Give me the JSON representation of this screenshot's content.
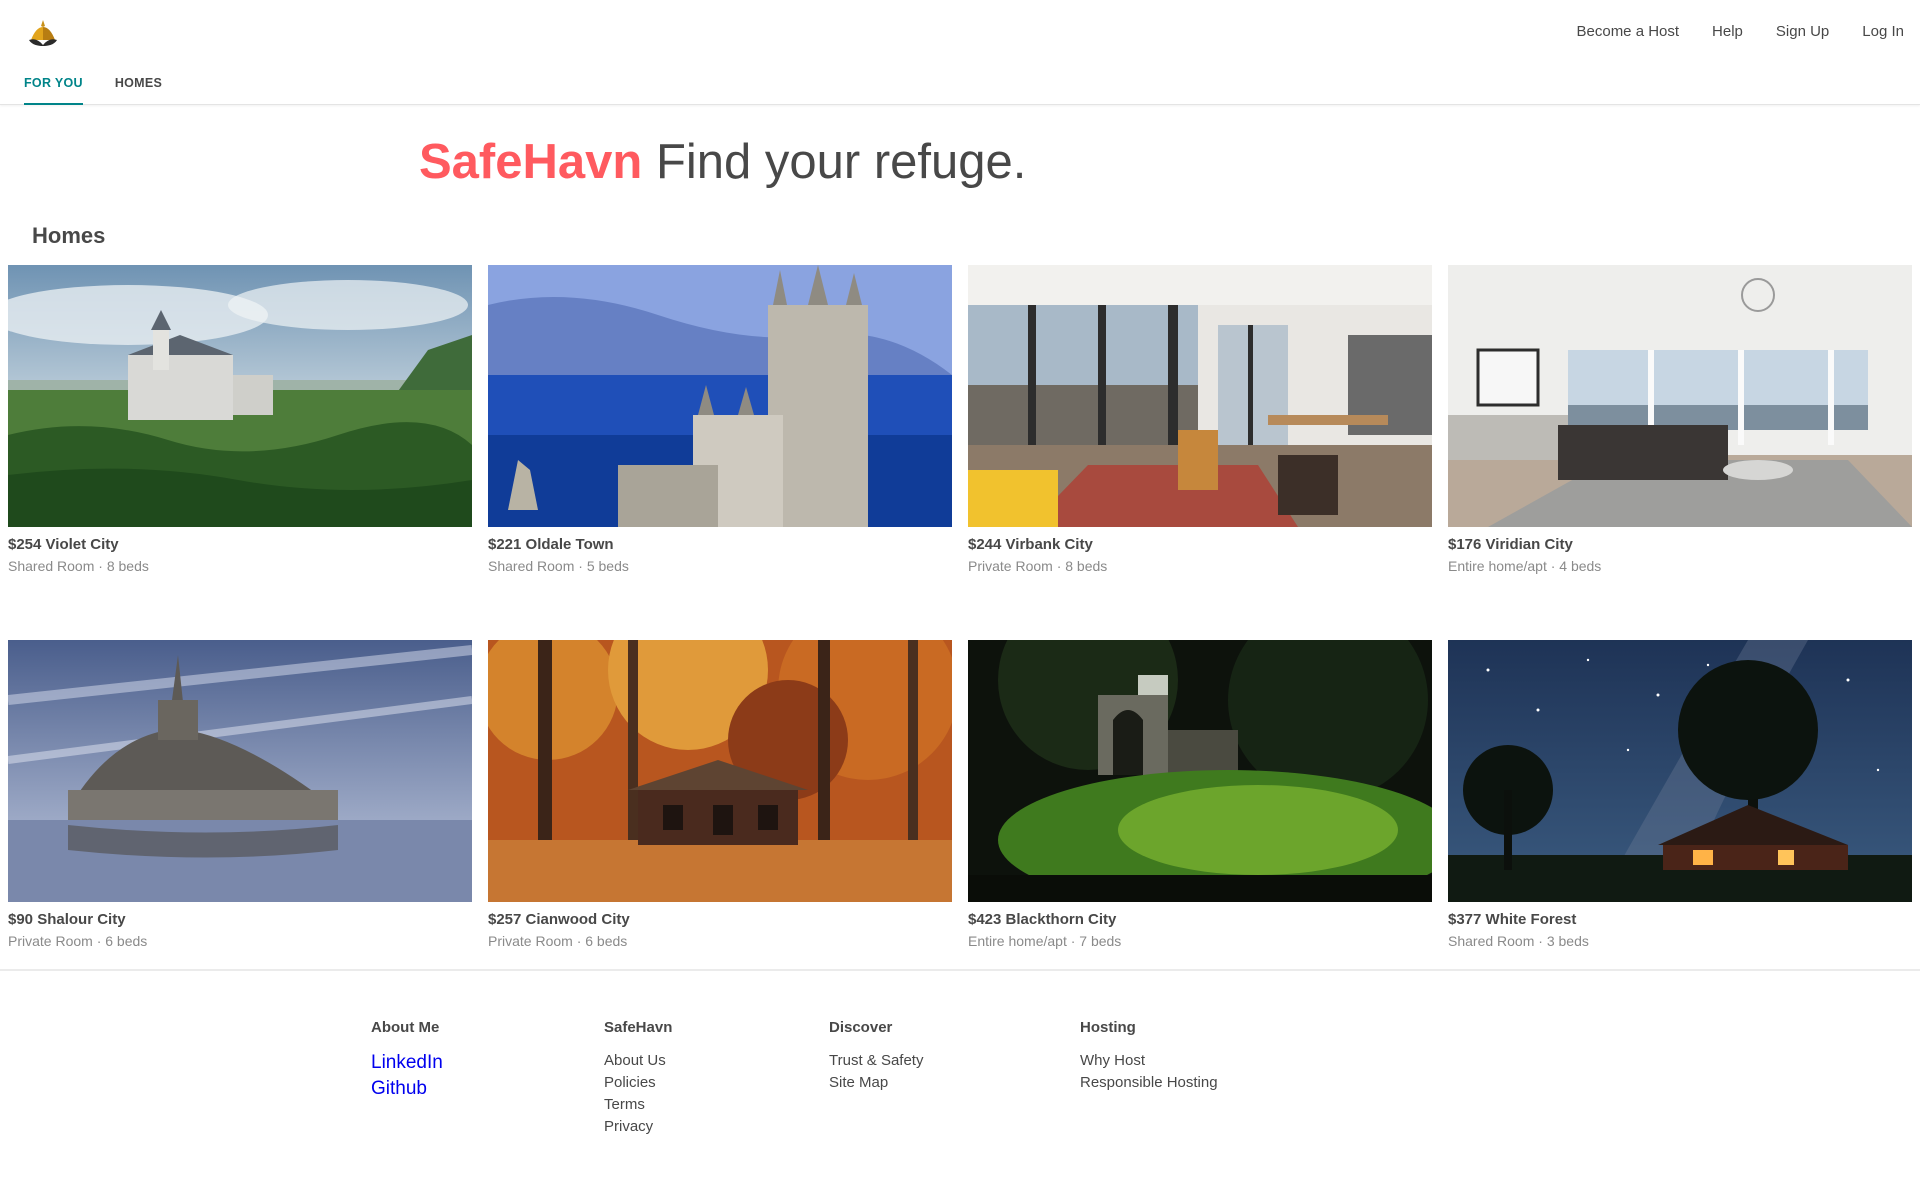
{
  "header": {
    "nav": [
      "Become a Host",
      "Help",
      "Sign Up",
      "Log In"
    ],
    "tabs": [
      "FOR YOU",
      "HOMES"
    ],
    "active_tab": "FOR YOU"
  },
  "hero": {
    "brand": "SafeHavn",
    "tagline": "Find your refuge."
  },
  "section_title": "Homes",
  "listings": [
    {
      "title": "$254 Violet City",
      "subtitle": "Shared Room · 8 beds",
      "image": "castle-mountains"
    },
    {
      "title": "$221 Oldale Town",
      "subtitle": "Shared Room · 5 beds",
      "image": "castle-sea"
    },
    {
      "title": "$244 Virbank City",
      "subtitle": "Private Room · 8 beds",
      "image": "modern-living-room"
    },
    {
      "title": "$176 Viridian City",
      "subtitle": "Entire home/apt · 4 beds",
      "image": "bright-living-room"
    },
    {
      "title": "$90 Shalour City",
      "subtitle": "Private Room · 6 beds",
      "image": "island-abbey"
    },
    {
      "title": "$257 Cianwood City",
      "subtitle": "Private Room · 6 beds",
      "image": "autumn-cabin"
    },
    {
      "title": "$423 Blackthorn City",
      "subtitle": "Entire home/apt · 7 beds",
      "image": "forest-ruins"
    },
    {
      "title": "$377 White Forest",
      "subtitle": "Shared Room · 3 beds",
      "image": "starry-cabin"
    }
  ],
  "footer": {
    "about": {
      "heading": "About Me",
      "links": [
        "LinkedIn",
        "Github"
      ]
    },
    "safehavn": {
      "heading": "SafeHavn",
      "links": [
        "About Us",
        "Policies",
        "Terms",
        "Privacy"
      ]
    },
    "discover": {
      "heading": "Discover",
      "links": [
        "Trust & Safety",
        "Site Map"
      ]
    },
    "hosting": {
      "heading": "Hosting",
      "links": [
        "Why Host",
        "Responsible Hosting"
      ]
    }
  },
  "colors": {
    "brand": "#ff5a5f",
    "accent": "#008489",
    "text": "#484848",
    "muted": "#8a8a8a",
    "link": "#0000ee"
  }
}
